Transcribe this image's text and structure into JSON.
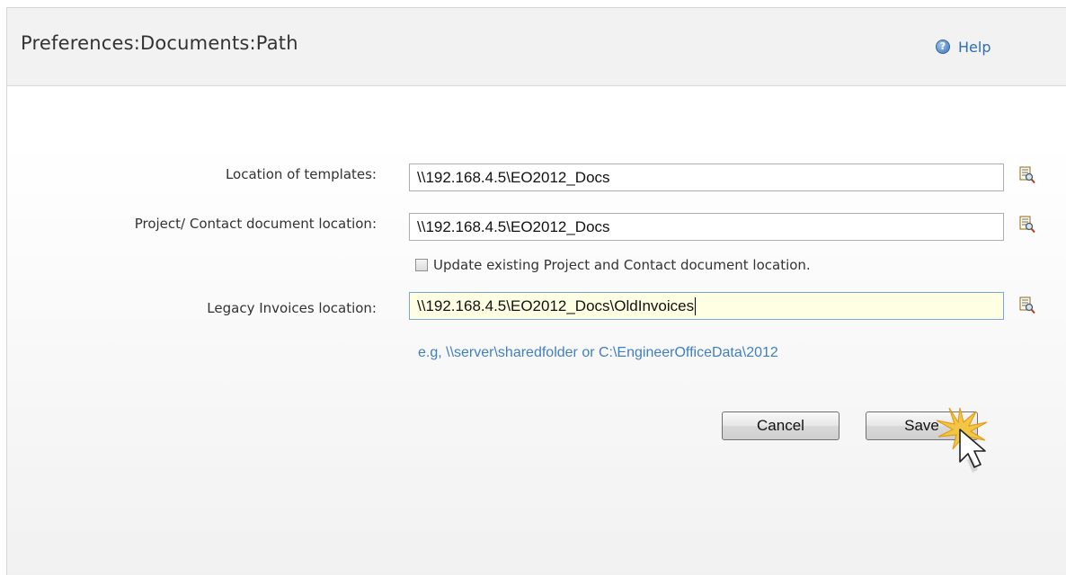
{
  "header": {
    "title": "Preferences:Documents:Path",
    "help_label": "Help"
  },
  "form": {
    "templates": {
      "label": "Location of templates:",
      "value": "\\\\192.168.4.5\\EO2012_Docs"
    },
    "project_contact": {
      "label": "Project/ Contact document location:",
      "value": "\\\\192.168.4.5\\EO2012_Docs"
    },
    "update_existing": {
      "label": "Update existing Project and Contact document location.",
      "checked": false
    },
    "legacy_invoices": {
      "label": "Legacy Invoices location:",
      "value": "\\\\192.168.4.5\\EO2012_Docs\\OldInvoices"
    },
    "hint": "e.g, \\\\server\\sharedfolder or C:\\EngineerOfficeData\\2012"
  },
  "buttons": {
    "cancel_label": "Cancel",
    "save_label": "Save"
  },
  "icons": {
    "help": "help-icon",
    "browse": "browse-folder-icon",
    "cursor": "mouse-pointer-icon"
  },
  "colors": {
    "link_blue": "#2c6fb6",
    "hint_blue": "#3f7fc2",
    "active_field_bg": "#ffffe3"
  }
}
